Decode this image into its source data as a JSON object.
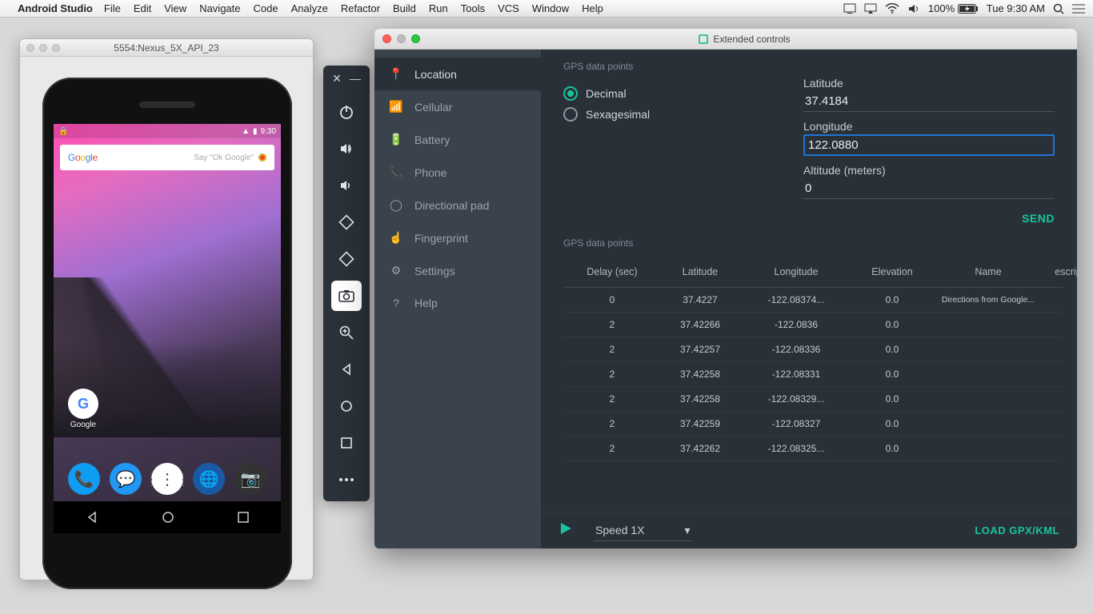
{
  "menubar": {
    "app": "Android Studio",
    "items": [
      "File",
      "Edit",
      "View",
      "Navigate",
      "Code",
      "Analyze",
      "Refactor",
      "Build",
      "Run",
      "Tools",
      "VCS",
      "Window",
      "Help"
    ],
    "battery": "100%",
    "clock": "Tue 9:30 AM"
  },
  "emulator": {
    "title": "5554:Nexus_5X_API_23",
    "status_time": "9:30",
    "search_hint": "Say \"Ok Google\"",
    "google_label": "Google"
  },
  "ext": {
    "title": "Extended controls",
    "side": {
      "location": "Location",
      "cellular": "Cellular",
      "battery": "Battery",
      "phone": "Phone",
      "dpad": "Directional pad",
      "fingerprint": "Fingerprint",
      "settings": "Settings",
      "help": "Help"
    },
    "section1": "GPS data points",
    "radio_decimal": "Decimal",
    "radio_sexagesimal": "Sexagesimal",
    "lat_label": "Latitude",
    "lat_value": "37.4184",
    "lon_label": "Longitude",
    "lon_value": "122.0880",
    "alt_label": "Altitude (meters)",
    "alt_value": "0",
    "send": "SEND",
    "section2": "GPS data points",
    "cols": {
      "delay": "Delay (sec)",
      "lat": "Latitude",
      "lon": "Longitude",
      "elev": "Elevation",
      "name": "Name",
      "desc": "escription"
    },
    "rows": [
      {
        "delay": "0",
        "lat": "37.4227",
        "lon": "-122.08374...",
        "elev": "0.0",
        "name": "Directions from Google...",
        "desc": ""
      },
      {
        "delay": "2",
        "lat": "37.42266",
        "lon": "-122.0836",
        "elev": "0.0",
        "name": "",
        "desc": ""
      },
      {
        "delay": "2",
        "lat": "37.42257",
        "lon": "-122.08336",
        "elev": "0.0",
        "name": "",
        "desc": ""
      },
      {
        "delay": "2",
        "lat": "37.42258",
        "lon": "-122.08331",
        "elev": "0.0",
        "name": "",
        "desc": ""
      },
      {
        "delay": "2",
        "lat": "37.42258",
        "lon": "-122.08329...",
        "elev": "0.0",
        "name": "",
        "desc": ""
      },
      {
        "delay": "2",
        "lat": "37.42259",
        "lon": "-122.08327",
        "elev": "0.0",
        "name": "",
        "desc": ""
      },
      {
        "delay": "2",
        "lat": "37.42262",
        "lon": "-122.08325...",
        "elev": "0.0",
        "name": "",
        "desc": ""
      }
    ],
    "speed": "Speed 1X",
    "load": "LOAD GPX/KML"
  }
}
